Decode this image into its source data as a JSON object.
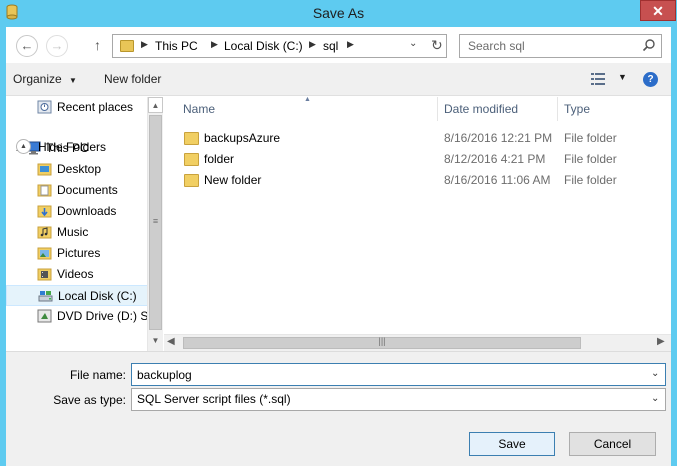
{
  "window": {
    "title": "Save As",
    "close_label": "✕"
  },
  "nav": {
    "address": {
      "crumbs": [
        "This PC",
        "Local Disk (C:)",
        "sql"
      ]
    },
    "search": {
      "placeholder": "Search sql"
    }
  },
  "toolbar": {
    "organize_label": "Organize",
    "new_folder_label": "New folder"
  },
  "sidebar": {
    "items": [
      {
        "label": "Recent places",
        "icon": "recent-places-icon"
      },
      {
        "label": "This PC",
        "icon": "computer-icon"
      },
      {
        "label": "Desktop",
        "icon": "folder-icon"
      },
      {
        "label": "Documents",
        "icon": "documents-icon"
      },
      {
        "label": "Downloads",
        "icon": "downloads-icon"
      },
      {
        "label": "Music",
        "icon": "music-icon"
      },
      {
        "label": "Pictures",
        "icon": "pictures-icon"
      },
      {
        "label": "Videos",
        "icon": "videos-icon"
      },
      {
        "label": "Local Disk (C:)",
        "icon": "drive-icon",
        "selected": true
      },
      {
        "label": "DVD Drive (D:) SC",
        "icon": "dvd-drive-icon"
      }
    ]
  },
  "filelist": {
    "columns": {
      "name": "Name",
      "date": "Date modified",
      "type": "Type"
    },
    "rows": [
      {
        "name": "backupsAzure",
        "date": "8/16/2016 12:21 PM",
        "type": "File folder"
      },
      {
        "name": "folder",
        "date": "8/12/2016 4:21 PM",
        "type": "File folder"
      },
      {
        "name": "New folder",
        "date": "8/16/2016 11:06 AM",
        "type": "File folder"
      }
    ]
  },
  "form": {
    "filename_label": "File name:",
    "filename_value": "backuplog",
    "savetype_label": "Save as type:",
    "savetype_value": "SQL Server script files (*.sql)"
  },
  "footer": {
    "hide_folders_label": "Hide Folders",
    "save_label": "Save",
    "cancel_label": "Cancel"
  },
  "colors": {
    "titlebar": "#5ecbf0",
    "close": "#c75050",
    "folder": "#f1cf63",
    "accent": "#3c7fb1"
  }
}
